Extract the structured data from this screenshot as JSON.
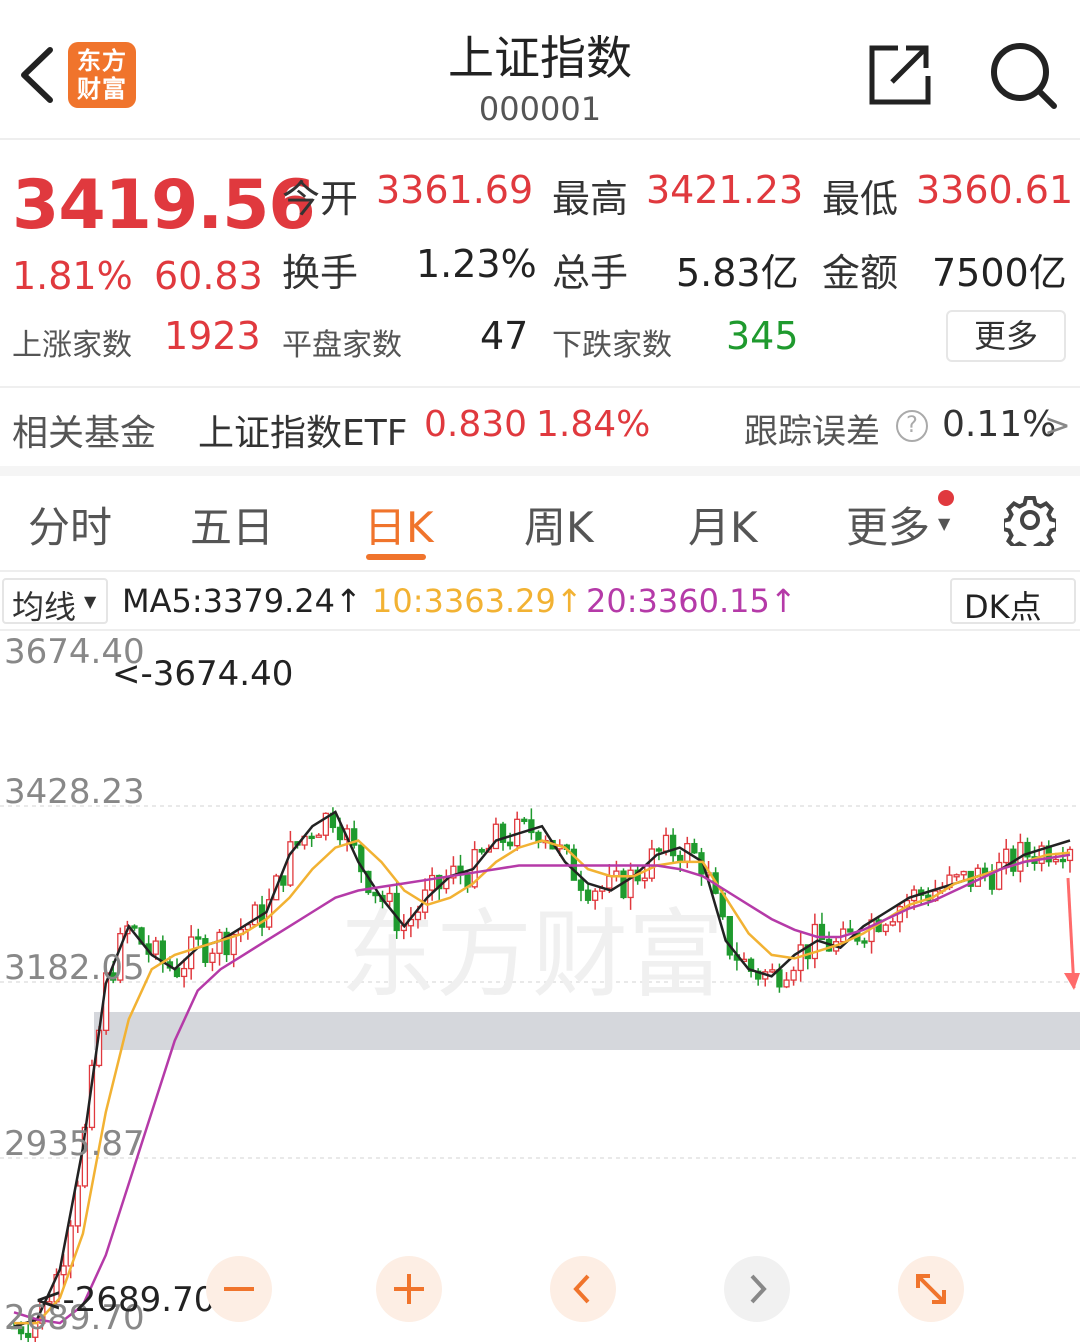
{
  "header": {
    "logo_line1": "东方",
    "logo_line2": "财富",
    "title": "上证指数",
    "code": "000001"
  },
  "quote": {
    "price": "3419.56",
    "change_pct": "1.81%",
    "change": "60.83",
    "open_label": "今开",
    "open": "3361.69",
    "high_label": "最高",
    "high": "3421.23",
    "low_label": "最低",
    "low": "3360.61",
    "turnover_label": "换手",
    "turnover": "1.23%",
    "volume_label": "总手",
    "volume": "5.83亿",
    "amount_label": "金额",
    "amount": "7500亿",
    "up_label": "上涨家数",
    "up_count": "1923",
    "flat_label": "平盘家数",
    "flat_count": "47",
    "down_label": "下跌家数",
    "down_count": "345",
    "more": "更多"
  },
  "fund": {
    "label": "相关基金",
    "name": "上证指数ETF",
    "price": "0.830",
    "pct": "1.84%",
    "tracking_label": "跟踪误差",
    "tracking_value": "0.11%",
    "chevron": ">"
  },
  "tabs": [
    "分时",
    "五日",
    "日K",
    "周K",
    "月K",
    "更多"
  ],
  "active_tab": "日K",
  "ma": {
    "selector": "均线",
    "ma5": "MA5:3379.24↑",
    "ma10": "10:3363.29↑",
    "ma20": "20:3360.15↑",
    "dk": "DK点"
  },
  "colors": {
    "up": "#e0393e",
    "down": "#1f9a2e",
    "accent": "#f0742c",
    "ma5": "#222222",
    "ma10": "#f2b233",
    "ma20": "#b53aa8"
  },
  "icons": [
    "back-arrow-icon",
    "share-icon",
    "search-icon",
    "settings-gear-icon",
    "zoom-out-icon",
    "zoom-in-icon",
    "prev-icon",
    "next-icon",
    "fullscreen-icon"
  ],
  "chart_data": {
    "type": "candlestick",
    "y_ticks": [
      "3674.40",
      "3428.23",
      "3182.05",
      "2935.87",
      "2689.70"
    ],
    "max_label": "<-3674.40",
    "min_label": "<-2689.70",
    "ylim": [
      2689.7,
      3674.4
    ],
    "ma5_approx": [
      2700,
      2710,
      2780,
      2950,
      3180,
      3260,
      3220,
      3200,
      3230,
      3240,
      3260,
      3280,
      3360,
      3400,
      3420,
      3350,
      3300,
      3260,
      3300,
      3330,
      3340,
      3380,
      3390,
      3400,
      3350,
      3320,
      3310,
      3330,
      3360,
      3370,
      3350,
      3240,
      3200,
      3190,
      3220,
      3240,
      3230,
      3260,
      3280,
      3300,
      3310,
      3320,
      3330,
      3340,
      3360,
      3370,
      3380
    ],
    "ma10_approx": [
      2705,
      2705,
      2740,
      2830,
      3000,
      3130,
      3200,
      3220,
      3230,
      3240,
      3250,
      3270,
      3300,
      3340,
      3370,
      3380,
      3350,
      3310,
      3290,
      3300,
      3320,
      3350,
      3370,
      3380,
      3370,
      3340,
      3330,
      3330,
      3345,
      3350,
      3350,
      3300,
      3250,
      3220,
      3215,
      3225,
      3235,
      3250,
      3270,
      3290,
      3300,
      3320,
      3330,
      3340,
      3350,
      3360,
      3363
    ],
    "ma20_approx": [
      2720,
      2710,
      2705,
      2730,
      2800,
      2900,
      3000,
      3100,
      3170,
      3200,
      3220,
      3240,
      3260,
      3280,
      3300,
      3310,
      3315,
      3320,
      3325,
      3330,
      3335,
      3340,
      3345,
      3345,
      3345,
      3345,
      3345,
      3345,
      3345,
      3340,
      3330,
      3310,
      3290,
      3270,
      3255,
      3245,
      3245,
      3255,
      3270,
      3285,
      3295,
      3310,
      3325,
      3340,
      3350,
      3355,
      3360
    ]
  }
}
